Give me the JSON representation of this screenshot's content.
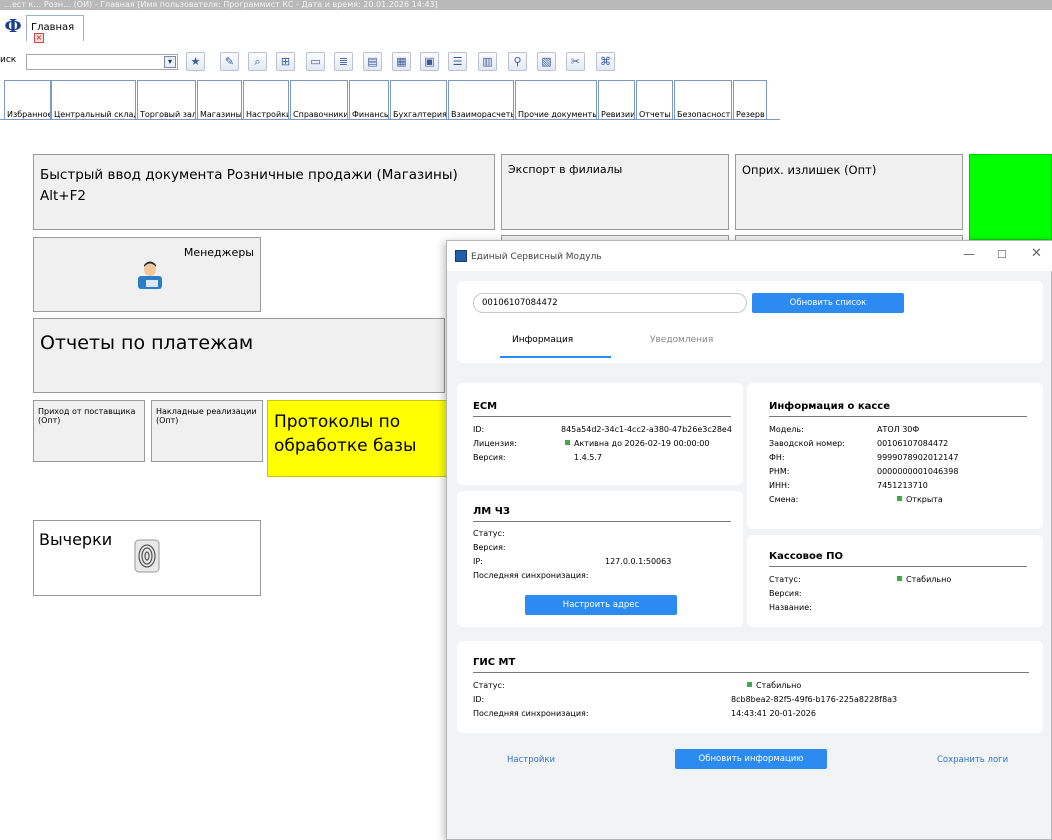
{
  "window": {
    "title": "…ест к… Розн… (ОИ) - Главная [Имя пользователя: Программист КС - Дата и время: 20.01.2026 14:43]",
    "logo": "Ф",
    "main_tab": "Главная"
  },
  "toolbar": {
    "search_label": "иск",
    "search_value": "",
    "buttons": [
      "star-icon",
      "edit-icon",
      "zoom-icon",
      "add-row-icon",
      "document-icon",
      "list-icon",
      "report-icon",
      "note-icon",
      "table-icon",
      "bullets-icon",
      "print-icon",
      "search-doc-icon",
      "color-doc-icon",
      "tools-icon",
      "network-icon"
    ]
  },
  "tabs": [
    "Избранное",
    "Центральный склад",
    "Торговый зал",
    "Магазины",
    "Настройки",
    "Справочники",
    "Финансы",
    "Бухгалтерия",
    "Взаиморасчеты",
    "Прочие документы",
    "Ревизии",
    "Отчеты",
    "Безопасность",
    "Резерв"
  ],
  "tiles": {
    "quick_input": "Быстрый ввод документа Розничные продажи (Магазины) Alt+F2",
    "export_branches": "Экспорт в филиалы",
    "surplus": "Оприх. излишек (Опт)",
    "managers": "Менеджеры",
    "payment_reports": "Отчеты по платежам",
    "supplier_receipt": "Приход от поставщика (Опт)",
    "sales_invoices": "Накладные реализации (Опт)",
    "db_protocols": "Протоколы по обработке базы",
    "crossings": "Вычерки",
    "green_tile_color": "#00ff00",
    "yellow_tile_color": "#ffff00"
  },
  "dialog": {
    "title": "Единый Сервисный Модуль",
    "device_select": "00106107084472",
    "refresh_list_btn": "Обновить список",
    "tabs": [
      "Информация",
      "Уведомления"
    ],
    "active_tab": "Информация",
    "ecm": {
      "title": "ЕСМ",
      "id_label": "ID:",
      "id_value": "845a54d2-34c1-4cc2-a380-47b26e3c28e4",
      "license_label": "Лицензия:",
      "license_value": "Активна до 2026-02-19 00:00:00",
      "version_label": "Версия:",
      "version_value": "1.4.5.7"
    },
    "lm": {
      "title": "ЛМ ЧЗ",
      "status_label": "Статус:",
      "version_label": "Версия:",
      "ip_label": "IP:",
      "ip_value": "127.0.0.1:50063",
      "sync_label": "Последняя синхронизация:",
      "configure_btn": "Настроить адрес"
    },
    "kassa": {
      "title": "Информация о кассе",
      "model_label": "Модель:",
      "model_value": "АТОЛ 30Ф",
      "serial_label": "Заводской номер:",
      "serial_value": "00106107084472",
      "fn_label": "ФН:",
      "fn_value": "9999078902012147",
      "rnm_label": "РНМ:",
      "rnm_value": "0000000001046398",
      "inn_label": "ИНН:",
      "inn_value": "7451213710",
      "shift_label": "Смена:",
      "shift_value": "Открыта"
    },
    "po": {
      "title": "Кассовое ПО",
      "status_label": "Статус:",
      "status_value": "Стабильно",
      "version_label": "Версия:",
      "name_label": "Название:"
    },
    "gis": {
      "title": "ГИС МТ",
      "status_label": "Статус:",
      "status_value": "Стабильно",
      "id_label": "ID:",
      "id_value": "8cb8bea2-82f5-49f6-b176-225a8228f8a3",
      "sync_label": "Последняя синхронизация:",
      "sync_value": "14:43:41 20-01-2026"
    },
    "footer": {
      "settings": "Настройки",
      "update_btn": "Обновить информацию",
      "save_logs": "Сохранить логи"
    },
    "status_color": "#40a846",
    "accent_color": "#2b8bf0"
  }
}
